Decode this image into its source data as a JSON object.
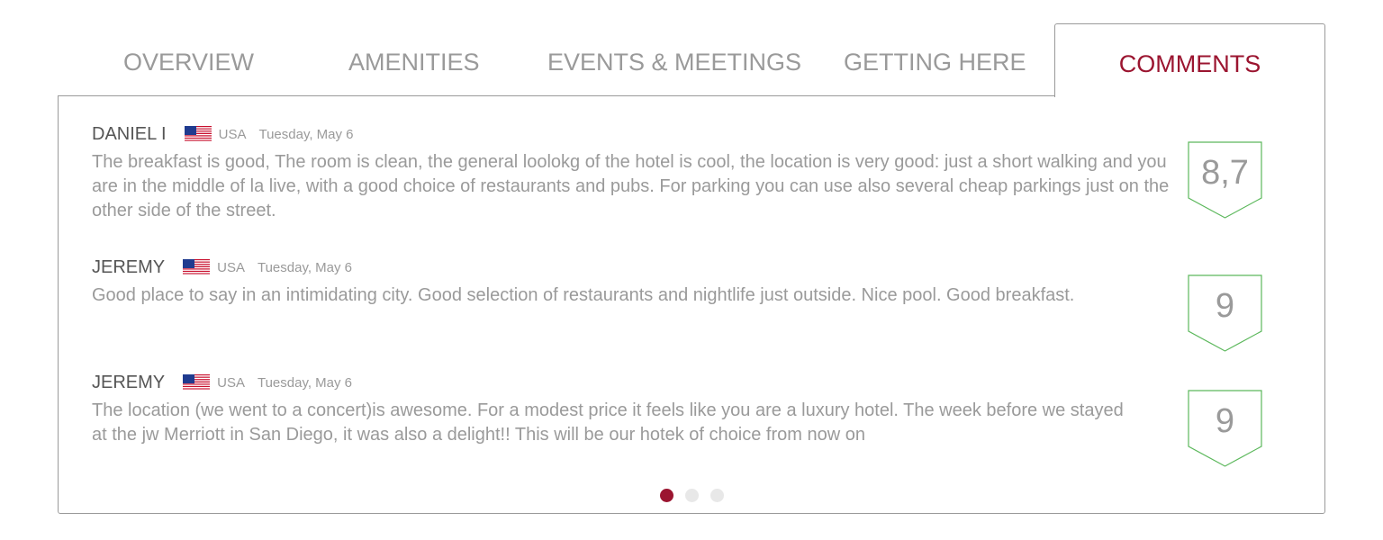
{
  "tabs": [
    {
      "label": "OVERVIEW"
    },
    {
      "label": "AMENITIES"
    },
    {
      "label": "EVENTS & MEETINGS"
    },
    {
      "label": "GETTING HERE"
    },
    {
      "label": "COMMENTS"
    }
  ],
  "active_tab": "COMMENTS",
  "colors": {
    "accent": "#9b1530",
    "text": "#9a9a9a",
    "score_border": "#5cb85c",
    "dot_inactive": "#e8e8e8"
  },
  "reviews": [
    {
      "author": "DANIEL I",
      "flag_icon": "us-flag-icon",
      "country": "USA",
      "date": "Tuesday, May 6",
      "text": "The breakfast is good, The room is clean, the general loolokg of the hotel is cool, the location is very good: just a short walking and you are in the middle of la live, with a good choice of restaurants and pubs. For parking you can use also several cheap parkings just on the other side of the street.",
      "score": "8,7"
    },
    {
      "author": "JEREMY",
      "flag_icon": "us-flag-icon",
      "country": "USA",
      "date": "Tuesday, May 6",
      "text": "Good place to say in an intimidating city. Good selection of restaurants and nightlife just outside. Nice pool. Good breakfast.",
      "score": "9"
    },
    {
      "author": "JEREMY",
      "flag_icon": "us-flag-icon",
      "country": "USA",
      "date": "Tuesday, May 6",
      "text": "The location (we went to a concert)is awesome. For a modest price it feels like you are a luxury hotel. The week before we stayed at the jw Merriott in San Diego, it was also a delight!! This will be our hotek of choice from now on",
      "score": "9"
    }
  ],
  "pagination": {
    "pages": 3,
    "current": 1
  }
}
